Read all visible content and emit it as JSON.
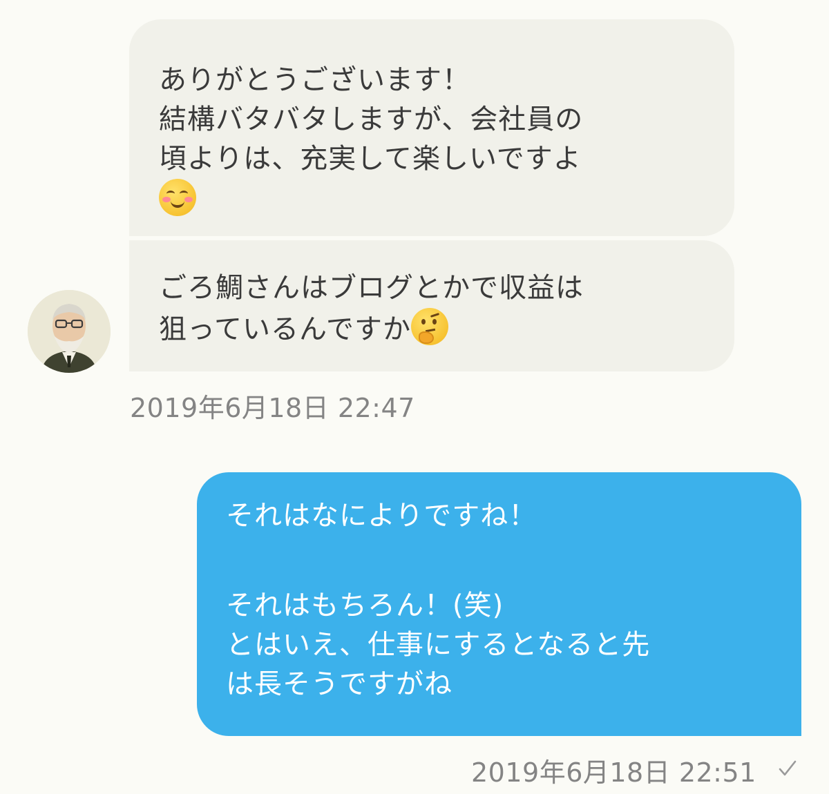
{
  "conversation": {
    "messages": [
      {
        "direction": "incoming",
        "lines": [
          "ありがとうございます！",
          "結構バタバタしますが、会社員の",
          "頃よりは、充実して楽しいですよ"
        ],
        "emoji": "smiling-face-with-blush-icon"
      },
      {
        "direction": "incoming",
        "lines": [
          "ごろ鯛さんはブログとかで収益は",
          "狙っているんですか"
        ],
        "emoji": "thinking-face-icon"
      },
      {
        "direction": "outgoing",
        "lines": [
          "それはなによりですね！",
          "",
          "それはもちろん！(笑)",
          "とはいえ、仕事にするとなると先",
          "は長そうですがね"
        ]
      }
    ],
    "timestamps": {
      "incoming": "2019年6月18日 22:47",
      "outgoing": "2019年6月18日 22:51"
    },
    "read_status_icon": "checkmark-icon"
  },
  "colors": {
    "background": "#fbfbf6",
    "incoming_bubble": "#f1f1ea",
    "outgoing_bubble": "#3cb1eb",
    "timestamp_text": "#848484"
  }
}
